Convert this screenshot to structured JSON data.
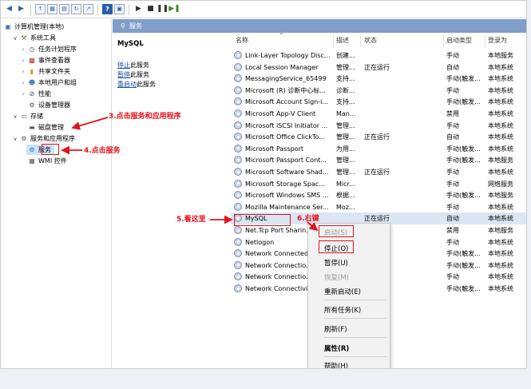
{
  "toolbar": {
    "buttons": [
      "back-icon",
      "forward-icon",
      "up-icon",
      "console-icon",
      "properties-icon",
      "refresh-icon",
      "export-icon",
      "help-icon",
      "show-icon",
      "play-icon",
      "stop-icon",
      "pause-icon",
      "restart-icon"
    ]
  },
  "tree": {
    "items": [
      {
        "label": "计算机管理(本地)",
        "icon": "computer-icon"
      },
      {
        "label": "系统工具",
        "icon": "tools-icon"
      },
      {
        "label": "任务计划程序",
        "icon": "clock-icon"
      },
      {
        "label": "事件查看器",
        "icon": "event-icon"
      },
      {
        "label": "共享文件夹",
        "icon": "folder-icon"
      },
      {
        "label": "本地用户和组",
        "icon": "users-icon"
      },
      {
        "label": "性能",
        "icon": "performance-icon"
      },
      {
        "label": "设备管理器",
        "icon": "device-icon"
      },
      {
        "label": "存储",
        "icon": "storage-icon"
      },
      {
        "label": "磁盘管理",
        "icon": "disk-icon"
      },
      {
        "label": "服务和应用程序",
        "icon": "services-apps-icon"
      },
      {
        "label": "服务",
        "icon": "services-icon"
      },
      {
        "label": "WMI 控件",
        "icon": "wmi-icon"
      }
    ]
  },
  "header": {
    "title": "服务"
  },
  "detail": {
    "title": "MySQL",
    "links": [
      {
        "link": "停止",
        "rest": "此服务"
      },
      {
        "link": "暂停",
        "rest": "此服务"
      },
      {
        "link": "重启动",
        "rest": "此服务"
      }
    ]
  },
  "table": {
    "columns": [
      "名称",
      "描述",
      "状态",
      "启动类型",
      "登录为"
    ],
    "rows": [
      [
        "Link-Layer Topology Disc...",
        "创建...",
        "",
        "手动",
        "本地服务"
      ],
      [
        "Local Session Manager",
        "管理...",
        "正在运行",
        "自动",
        "本地系统"
      ],
      [
        "MessagingService_65499",
        "支持...",
        "",
        "手动(触发...",
        "本地系统"
      ],
      [
        "Microsoft (R) 诊断中心标...",
        "诊断...",
        "",
        "手动",
        "本地系统"
      ],
      [
        "Microsoft Account Sign-i...",
        "支持...",
        "",
        "手动(触发...",
        "本地系统"
      ],
      [
        "Microsoft App-V Client",
        "Man...",
        "",
        "禁用",
        "本地系统"
      ],
      [
        "Microsoft iSCSI Initiator ...",
        "管理...",
        "",
        "手动",
        "本地系统"
      ],
      [
        "Microsoft Office ClickTo...",
        "管理...",
        "正在运行",
        "自动",
        "本地系统"
      ],
      [
        "Microsoft Passport",
        "为用...",
        "",
        "手动(触发...",
        "本地系统"
      ],
      [
        "Microsoft Passport Cont...",
        "管理...",
        "",
        "手动(触发...",
        "本地服务"
      ],
      [
        "Microsoft Software Shad...",
        "管理...",
        "正在运行",
        "手动",
        "本地系统"
      ],
      [
        "Microsoft Storage Spac...",
        "Micr...",
        "",
        "手动",
        "网络服务"
      ],
      [
        "Microsoft Windows SMS ...",
        "根据...",
        "",
        "手动(触发...",
        "本地服务"
      ],
      [
        "Mozilla Maintenance Ser...",
        "Moz...",
        "",
        "手动",
        "本地系统"
      ],
      [
        "MySQL",
        "",
        "正在运行",
        "自动",
        "本地系统"
      ],
      [
        "Net.Tcp Port Sharin...",
        "",
        "",
        "禁用",
        "本地服务"
      ],
      [
        "Netlogon",
        "",
        "",
        "手动",
        "本地系统"
      ],
      [
        "Network Connected...",
        "",
        "",
        "手动(触发...",
        "本地系统"
      ],
      [
        "Network Connectio...",
        "",
        "",
        "手动(触发...",
        "本地系统"
      ],
      [
        "Network Connectio...",
        "",
        "",
        "手动",
        "本地系统"
      ],
      [
        "Network Connectivi...",
        "",
        "",
        "手动(触发...",
        "本地系统"
      ]
    ]
  },
  "context_menu": {
    "items": [
      {
        "label": "启动(S)",
        "disabled": true
      },
      {
        "label": "停止(O)",
        "disabled": false
      },
      {
        "label": "暂停(U)",
        "disabled": false
      },
      {
        "label": "恢复(M)",
        "disabled": true
      },
      {
        "label": "重新启动(E)",
        "disabled": false
      },
      {
        "label": "所有任务(K)",
        "disabled": false
      },
      {
        "label": "刷新(F)",
        "disabled": false
      },
      {
        "label": "属性(R)",
        "disabled": false
      },
      {
        "label": "帮助(H)",
        "disabled": false
      }
    ]
  },
  "annotations": {
    "step3": "3.点击服务和应用程序",
    "step4": "4.点击服务",
    "step5": "5.看这里",
    "step6": "6.右键"
  },
  "colors": {
    "annotation": "#e0141b",
    "header_bar": "#7f9fc8",
    "link": "#1a4fa0",
    "selection": "#cce4f7"
  }
}
